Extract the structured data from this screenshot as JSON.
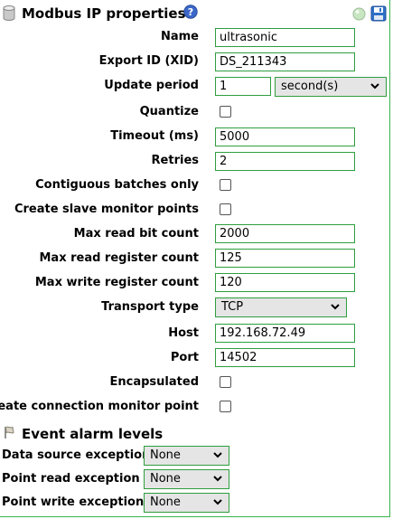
{
  "header": {
    "title": "Modbus IP properties",
    "icons": [
      "database-icon",
      "help-icon",
      "status-led-icon",
      "save-icon"
    ]
  },
  "fields": {
    "name_label": "Name",
    "name_value": "ultrasonic",
    "xid_label": "Export ID (XID)",
    "xid_value": "DS_211343",
    "update_label": "Update period",
    "update_value": "1",
    "update_unit": "second(s)",
    "quantize_label": "Quantize",
    "timeout_label": "Timeout (ms)",
    "timeout_value": "5000",
    "retries_label": "Retries",
    "retries_value": "2",
    "contig_label": "Contiguous batches only",
    "slave_label": "Create slave monitor points",
    "max_bit_label": "Max read bit count",
    "max_bit_value": "2000",
    "max_reg_label": "Max read register count",
    "max_reg_value": "125",
    "max_write_label": "Max write register count",
    "max_write_value": "120",
    "transport_label": "Transport type",
    "transport_value": "TCP",
    "host_label": "Host",
    "host_value": "192.168.72.49",
    "port_label": "Port",
    "port_value": "14502",
    "encap_label": "Encapsulated",
    "conn_label": "Create connection monitor point"
  },
  "alarms": {
    "title": "Event alarm levels",
    "ds_label": "Data source exception",
    "ds_value": "None",
    "pr_label": "Point read exception",
    "pr_value": "None",
    "pw_label": "Point write exception",
    "pw_value": "None"
  },
  "colors": {
    "border": "#2e9e3e",
    "panel_edge": "#39b54a",
    "help": "#3b67c9",
    "save": "#2f6fc7"
  }
}
